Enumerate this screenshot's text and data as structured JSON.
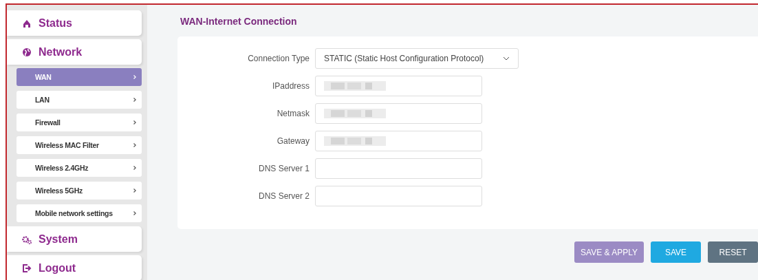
{
  "sidebar": {
    "items": [
      {
        "label": "Status"
      },
      {
        "label": "Network",
        "children": [
          {
            "label": "WAN",
            "selected": true
          },
          {
            "label": "LAN",
            "selected": false
          },
          {
            "label": "Firewall",
            "selected": false
          },
          {
            "label": "Wireless MAC Filter",
            "selected": false
          },
          {
            "label": "Wireless 2.4GHz",
            "selected": false
          },
          {
            "label": "Wireless 5GHz",
            "selected": false
          },
          {
            "label": "Mobile network settings",
            "selected": false
          }
        ]
      },
      {
        "label": "System"
      },
      {
        "label": "Logout"
      }
    ]
  },
  "page": {
    "title": "WAN-Internet Connection"
  },
  "form": [
    {
      "kind": "select",
      "label": "Connection Type",
      "value": "STATIC (Static Host Configuration Protocol)"
    },
    {
      "kind": "text",
      "label": "IPaddress",
      "redacted": true
    },
    {
      "kind": "text",
      "label": "Netmask",
      "redacted": true
    },
    {
      "kind": "text",
      "label": "Gateway",
      "redacted": true
    },
    {
      "kind": "text",
      "label": "DNS Server 1",
      "redacted": false
    },
    {
      "kind": "text",
      "label": "DNS Server 2",
      "redacted": false
    }
  ],
  "buttons": [
    {
      "label": "SAVE & APPLY",
      "kind": "apply"
    },
    {
      "label": "SAVE",
      "kind": "save"
    },
    {
      "label": "RESET",
      "kind": "reset"
    }
  ]
}
